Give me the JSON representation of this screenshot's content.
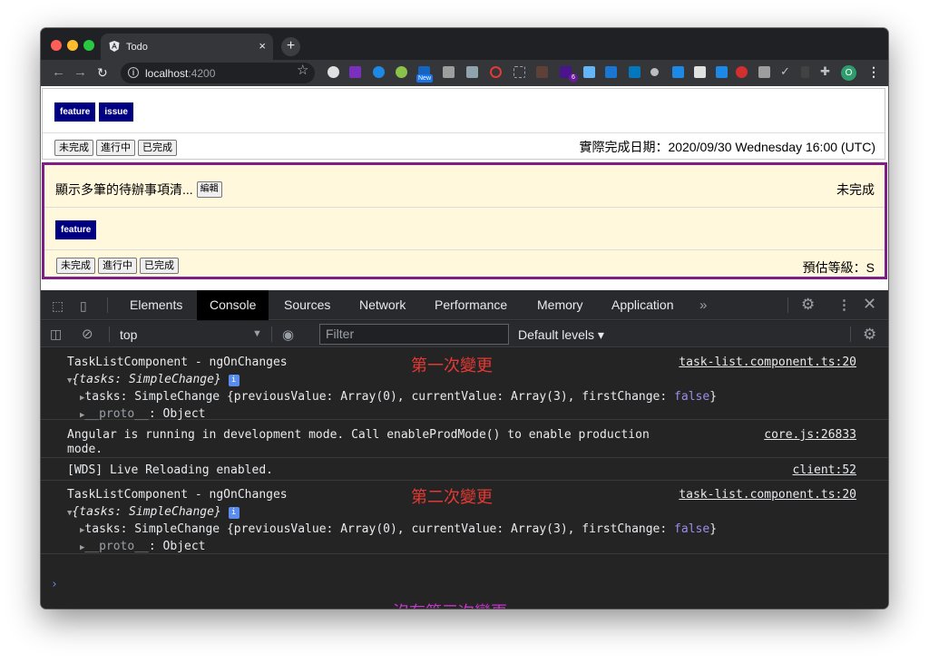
{
  "browser": {
    "tab_title": "Todo",
    "tab_close": "×",
    "new_tab": "+",
    "url_host": "localhost",
    "url_port": ":4200",
    "ext_new_label": "New",
    "ext_badge_count": "6",
    "profile_initial": "O"
  },
  "cards": [
    {
      "tags": [
        "feature",
        "issue"
      ],
      "status_buttons": [
        "未完成",
        "進行中",
        "已完成"
      ],
      "date_text": "實際完成日期：2020/09/30 Wednesday 16:00 (UTC)"
    },
    {
      "title": "顯示多筆的待辦事項清...",
      "edit_label": "編輯",
      "state": "未完成",
      "tags": [
        "feature"
      ],
      "status_buttons": [
        "未完成",
        "進行中",
        "已完成"
      ],
      "estimate_text": "預估等級：S",
      "border_color": "#7f1f86",
      "background": "#fff8dc"
    }
  ],
  "devtools": {
    "tabs": [
      "Elements",
      "Console",
      "Sources",
      "Network",
      "Performance",
      "Memory",
      "Application"
    ],
    "active_tab": "Console",
    "more": "»",
    "context": "top",
    "filter_placeholder": "Filter",
    "levels": "Default levels ▾"
  },
  "console": {
    "messages": [
      {
        "title": "TaskListComponent - ngOnChanges",
        "obj": "{tasks: SimpleChange}",
        "child_key": "tasks",
        "child_value": ": SimpleChange {previousValue: Array(0), currentValue: Array(3), firstChange: ",
        "child_bool": "false",
        "child_end": "}",
        "proto_key": "__proto__",
        "proto_value": ": Object",
        "source": "task-list.component.ts:20"
      },
      {
        "line1": "Angular is running in development mode. Call enableProdMode() to enable production",
        "line2": "mode.",
        "source": "core.js:26833"
      },
      {
        "line1": "[WDS] Live Reloading enabled.",
        "source": "client:52"
      },
      {
        "title": "TaskListComponent - ngOnChanges",
        "obj": "{tasks: SimpleChange}",
        "child_key": "tasks",
        "child_value": ": SimpleChange {previousValue: Array(0), currentValue: Array(3), firstChange: ",
        "child_bool": "false",
        "child_end": "}",
        "proto_key": "__proto__",
        "proto_value": ": Object",
        "source": "task-list.component.ts:20"
      }
    ],
    "annotations": {
      "first": "第一次變更",
      "second": "第二次變更",
      "third": "沒有第三次變更"
    },
    "prompt": "›"
  }
}
